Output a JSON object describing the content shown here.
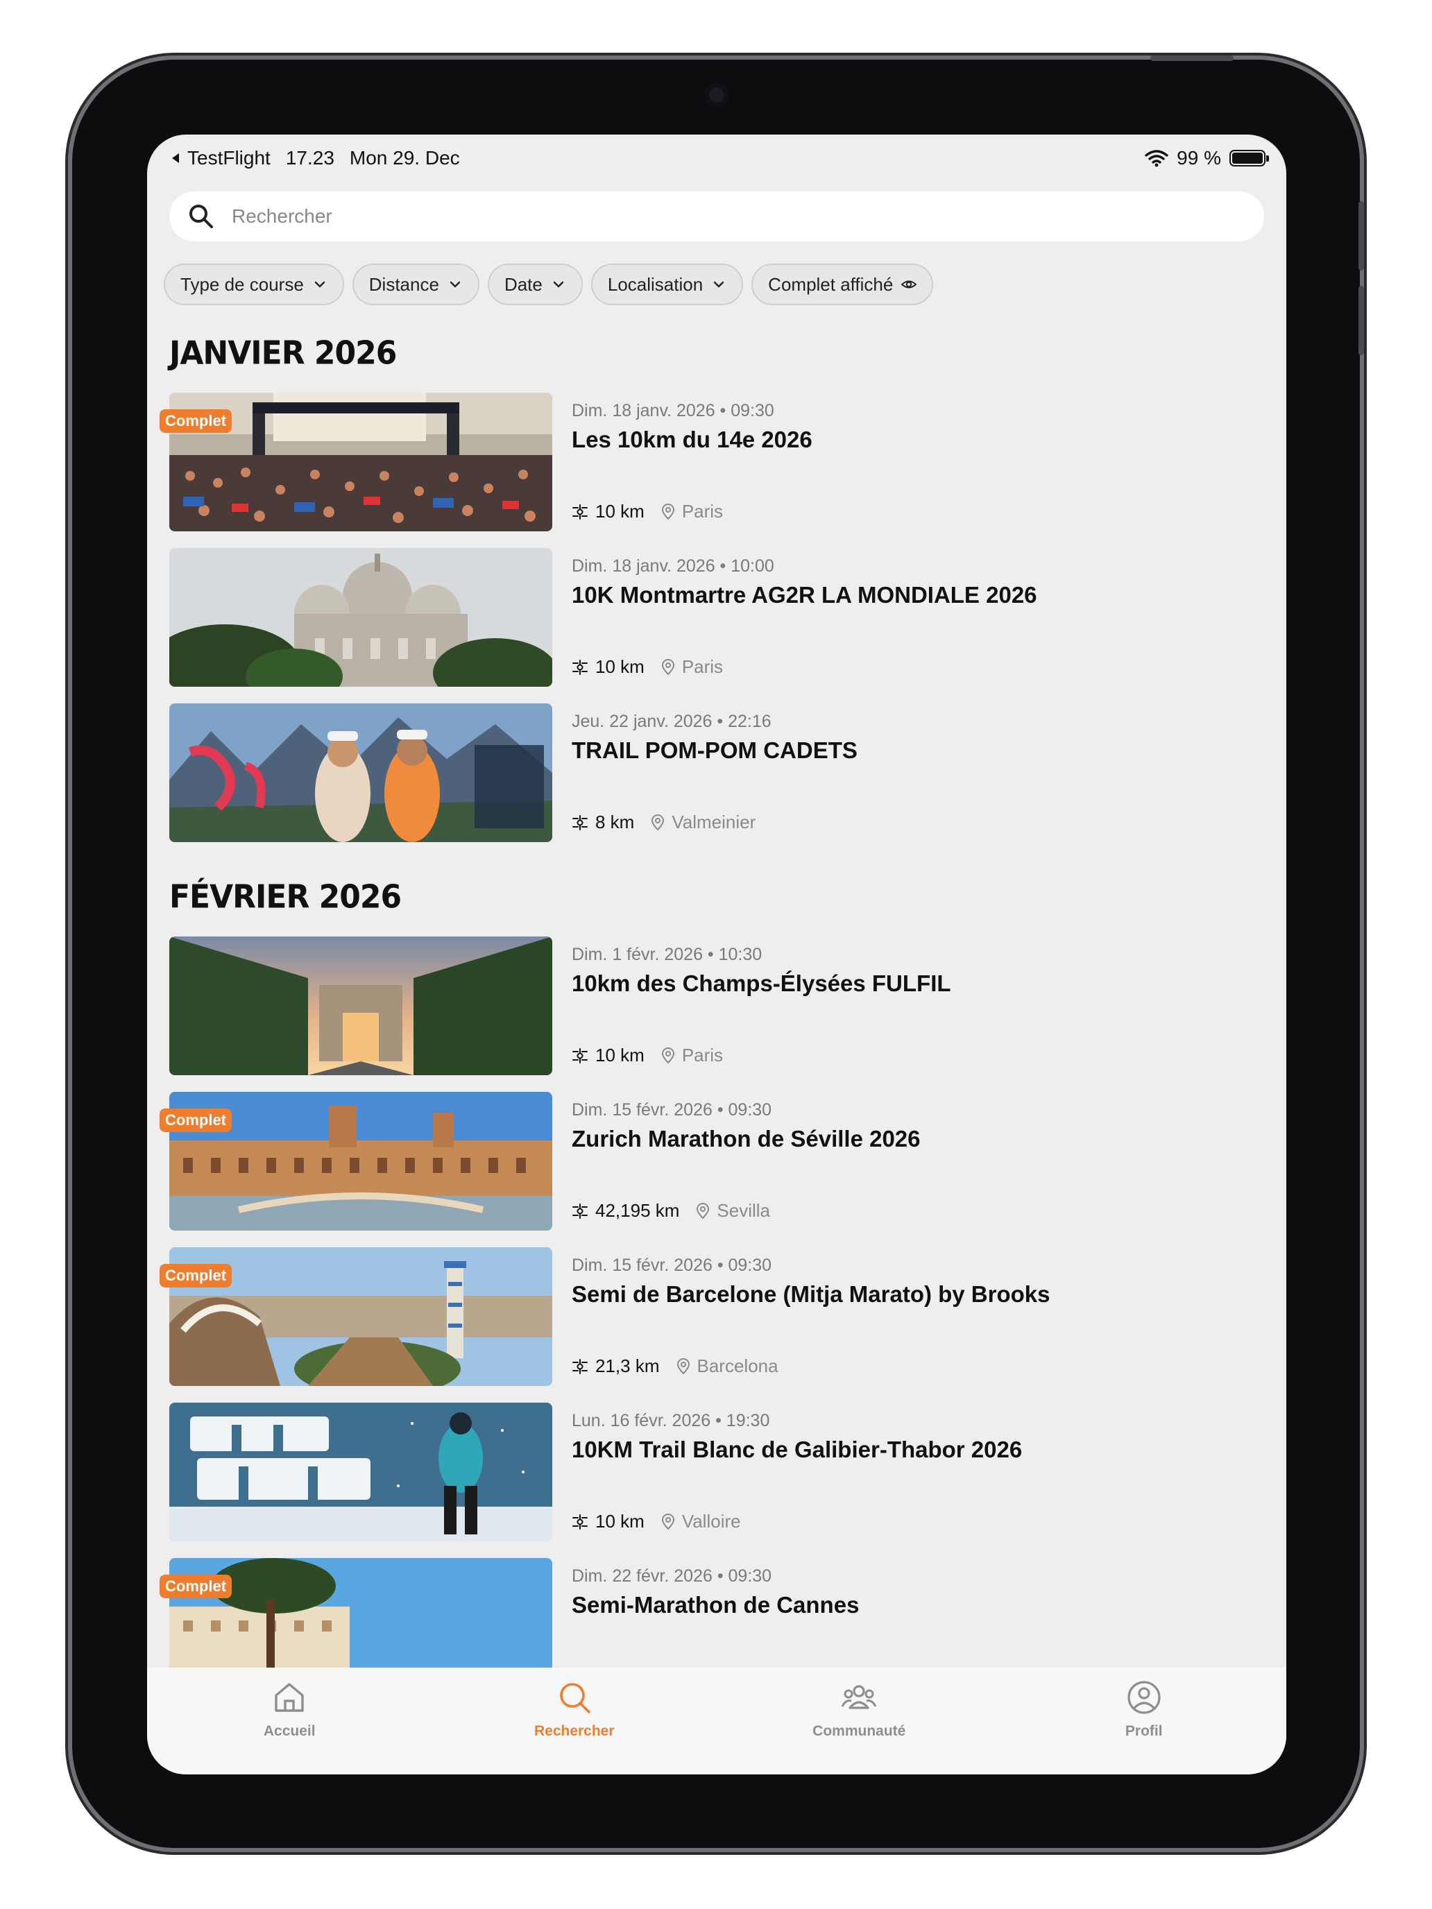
{
  "status_bar": {
    "back_app": "TestFlight",
    "time": "17.23",
    "date": "Mon 29. Dec",
    "battery": "99 %"
  },
  "search": {
    "placeholder": "Rechercher"
  },
  "filters": [
    {
      "label": "Type de course",
      "icon": "chevron-down-icon"
    },
    {
      "label": "Distance",
      "icon": "chevron-down-icon"
    },
    {
      "label": "Date",
      "icon": "chevron-down-icon"
    },
    {
      "label": "Localisation",
      "icon": "chevron-down-icon"
    },
    {
      "label": "Complet affiché",
      "icon": "eye-icon"
    }
  ],
  "badge_label": "Complet",
  "months": [
    {
      "title": "JANVIER 2026",
      "events": [
        {
          "date": "Dim. 18 janv. 2026 • 09:30",
          "title": "Les 10km du 14e 2026",
          "distance": "10 km",
          "location": "Paris",
          "complet": true
        },
        {
          "date": "Dim. 18 janv. 2026 • 10:00",
          "title": "10K Montmartre AG2R LA MONDIALE 2026",
          "distance": "10 km",
          "location": "Paris",
          "complet": false
        },
        {
          "date": "Jeu. 22 janv. 2026 • 22:16",
          "title": "TRAIL POM-POM CADETS",
          "distance": "8 km",
          "location": "Valmeinier",
          "complet": false
        }
      ]
    },
    {
      "title": "FÉVRIER 2026",
      "events": [
        {
          "date": "Dim. 1 févr. 2026 • 10:30",
          "title": "10km des Champs-Élysées FULFIL",
          "distance": "10 km",
          "location": "Paris",
          "complet": false
        },
        {
          "date": "Dim. 15 févr. 2026 • 09:30",
          "title": "Zurich Marathon de Séville 2026",
          "distance": "42,195 km",
          "location": "Sevilla",
          "complet": true
        },
        {
          "date": "Dim. 15 févr. 2026 • 09:30",
          "title": "Semi de Barcelone (Mitja Marato) by Brooks",
          "distance": "21,3 km",
          "location": "Barcelona",
          "complet": true
        },
        {
          "date": "Lun. 16 févr. 2026 • 19:30",
          "title": "10KM Trail Blanc de Galibier-Thabor 2026",
          "distance": "10 km",
          "location": "Valloire",
          "complet": false
        },
        {
          "date": "Dim. 22 févr. 2026 • 09:30",
          "title": "Semi-Marathon de Cannes",
          "distance": "",
          "location": "",
          "complet": true
        }
      ]
    }
  ],
  "tabs": [
    {
      "label": "Accueil",
      "icon": "home-icon",
      "active": false
    },
    {
      "label": "Rechercher",
      "icon": "search-icon",
      "active": true
    },
    {
      "label": "Communauté",
      "icon": "community-icon",
      "active": false
    },
    {
      "label": "Profil",
      "icon": "profile-icon",
      "active": false
    }
  ],
  "colors": {
    "accent": "#ef7d2e",
    "background": "#eeeeee",
    "text": "#111111",
    "muted": "#7a7a7a"
  }
}
